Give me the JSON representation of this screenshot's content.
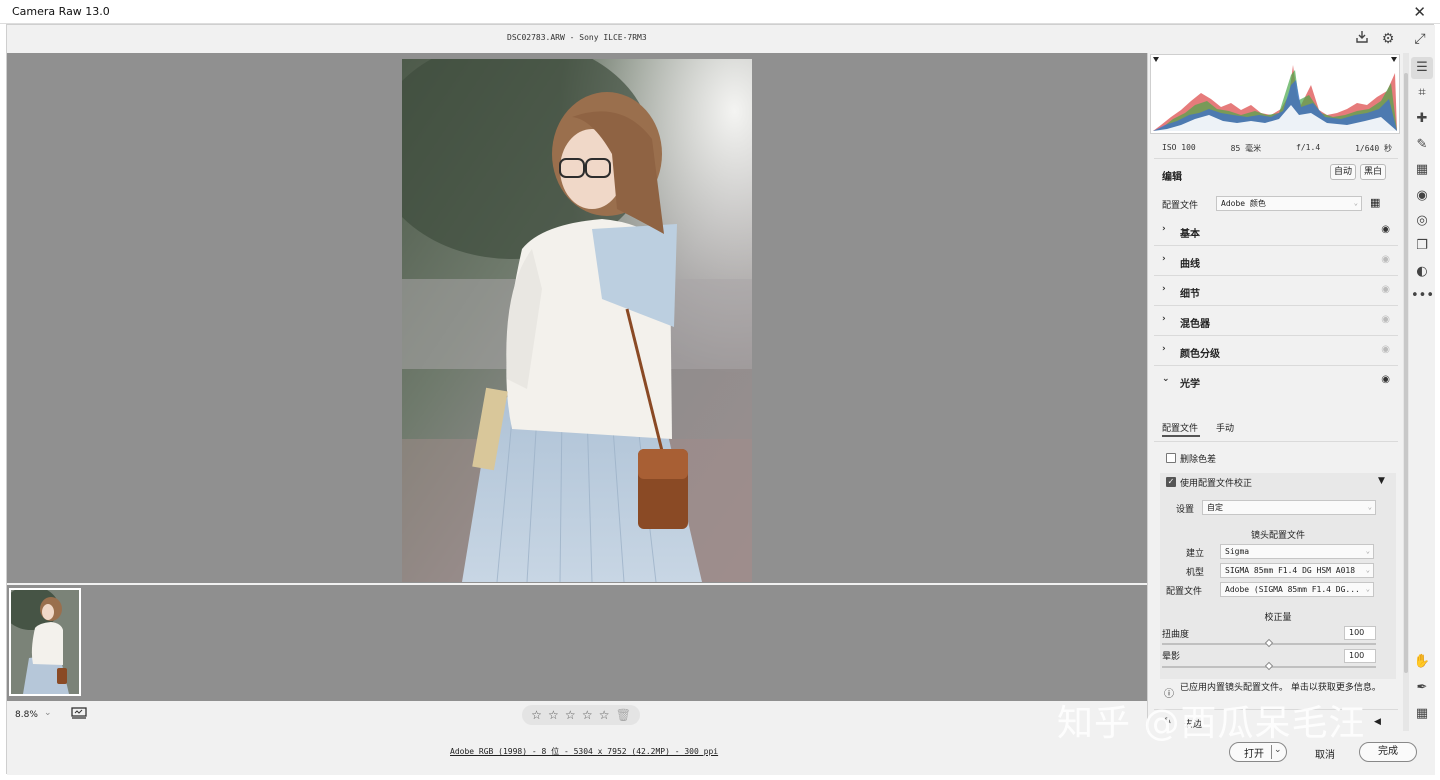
{
  "window": {
    "title": "Camera Raw 13.0",
    "close_glyph": "✕"
  },
  "header": {
    "file_info": "DSC02783.ARW  -  Sony ILCE-7RM3",
    "icons": [
      "save-icon",
      "gear-icon",
      "fullscreen-icon"
    ]
  },
  "status": {
    "zoom": "8.8%",
    "rating_stars": [
      "☆",
      "☆",
      "☆",
      "☆",
      "☆"
    ],
    "rating_value": 0,
    "color_info": "Adobe RGB (1998) - 8 位 - 5304 x 7952 (42.2MP) - 300 ppi"
  },
  "footer": {
    "open_label": "打开",
    "cancel_label": "取消",
    "done_label": "完成"
  },
  "watermark": "知乎 @西瓜呆毛汪",
  "exif": {
    "iso": "ISO 100",
    "focal": "85 毫米",
    "aperture": "f/1.4",
    "shutter": "1/640 秒"
  },
  "edit": {
    "title": "编辑",
    "auto_label": "自动",
    "bw_label": "黑白",
    "profile_label": "配置文件",
    "profile_value": "Adobe 颜色"
  },
  "sections": [
    {
      "label": "基本",
      "expanded": false,
      "visible": true
    },
    {
      "label": "曲线",
      "expanded": false,
      "visible": false
    },
    {
      "label": "细节",
      "expanded": false,
      "visible": false
    },
    {
      "label": "混色器",
      "expanded": false,
      "visible": false
    },
    {
      "label": "颜色分级",
      "expanded": false,
      "visible": false
    },
    {
      "label": "光学",
      "expanded": true,
      "visible": true
    }
  ],
  "optics": {
    "tab_profile": "配置文件",
    "tab_manual": "手动",
    "remove_ca_label": "删除色差",
    "remove_ca_checked": false,
    "use_profile_label": "使用配置文件校正",
    "use_profile_checked": true,
    "setup_label": "设置",
    "setup_value": "自定",
    "lens_profile_title": "镜头配置文件",
    "make_label": "建立",
    "make_value": "Sigma",
    "model_label": "机型",
    "model_value": "SIGMA 85mm F1.4 DG HSM A018",
    "profile_label": "配置文件",
    "profile_value": "Adobe (SIGMA 85mm F1.4 DG...",
    "amount_title": "校正量",
    "distortion_label": "扭曲度",
    "distortion_value": "100",
    "distortion_level": 0.5,
    "vignette_label": "晕影",
    "vignette_value": "100",
    "vignette_level": 0.5,
    "info_text": "已应用内置镜头配置文件。  单击以获取更多信息。",
    "defringe_label": "去边"
  },
  "tools": [
    "sliders-icon",
    "crop-icon",
    "heal-icon",
    "brush-icon",
    "gradient-icon",
    "radial-icon",
    "redeye-icon",
    "snapshots-icon",
    "presets-icon",
    "more-icon",
    "hand-icon",
    "eyedropper-icon",
    "grid-icon"
  ],
  "colors": {
    "canvas": "#909090",
    "panel": "#f1f1f1",
    "accent": "#555555"
  }
}
